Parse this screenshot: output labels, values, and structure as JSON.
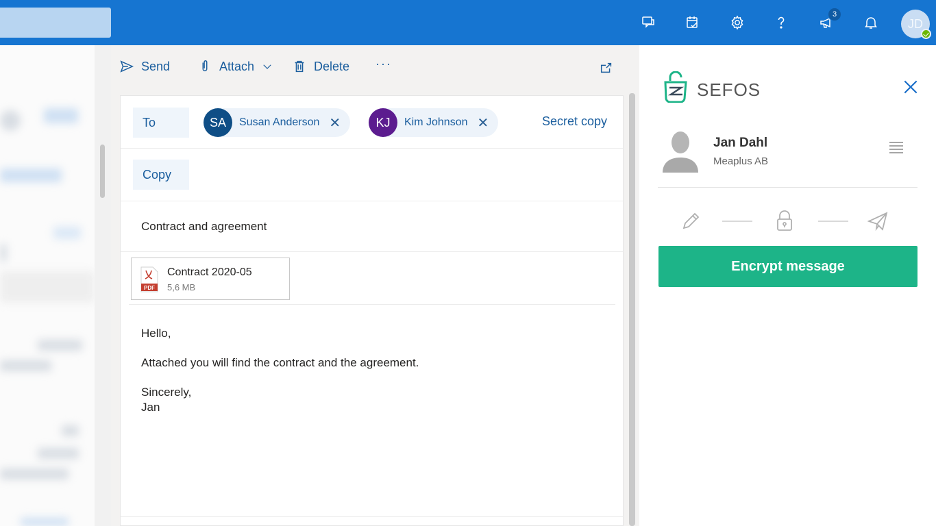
{
  "topbar": {
    "icons": [
      "feedback-icon",
      "calendar-check-icon",
      "gear-icon",
      "help-icon",
      "megaphone-icon",
      "bell-icon"
    ],
    "whats_new_count": "3",
    "user_initials": "JD",
    "accent": "#1675d1"
  },
  "toolbar": {
    "send_label": "Send",
    "attach_label": "Attach",
    "delete_label": "Delete",
    "more_label": "···"
  },
  "compose": {
    "to_label": "To",
    "copy_label": "Copy",
    "secret_copy_label": "Secret copy",
    "recipients": [
      {
        "initials": "SA",
        "name": "Susan Anderson",
        "color": "#0f4e86"
      },
      {
        "initials": "KJ",
        "name": "Kim Johnson",
        "color": "#5c1c8f"
      }
    ],
    "subject": "Contract and agreement",
    "attachment": {
      "name": "Contract 2020-05",
      "size": "5,6 MB",
      "type": "PDF"
    },
    "body": {
      "greeting": "Hello,",
      "line1": "Attached you will find the contract and the agreement.",
      "closing": "Sincerely,",
      "signature": "Jan"
    }
  },
  "panel": {
    "brand": "SEFOS",
    "user_name": "Jan Dahl",
    "user_org": "Meaplus AB",
    "encrypt_label": "Encrypt message",
    "brand_color": "#1db488"
  }
}
